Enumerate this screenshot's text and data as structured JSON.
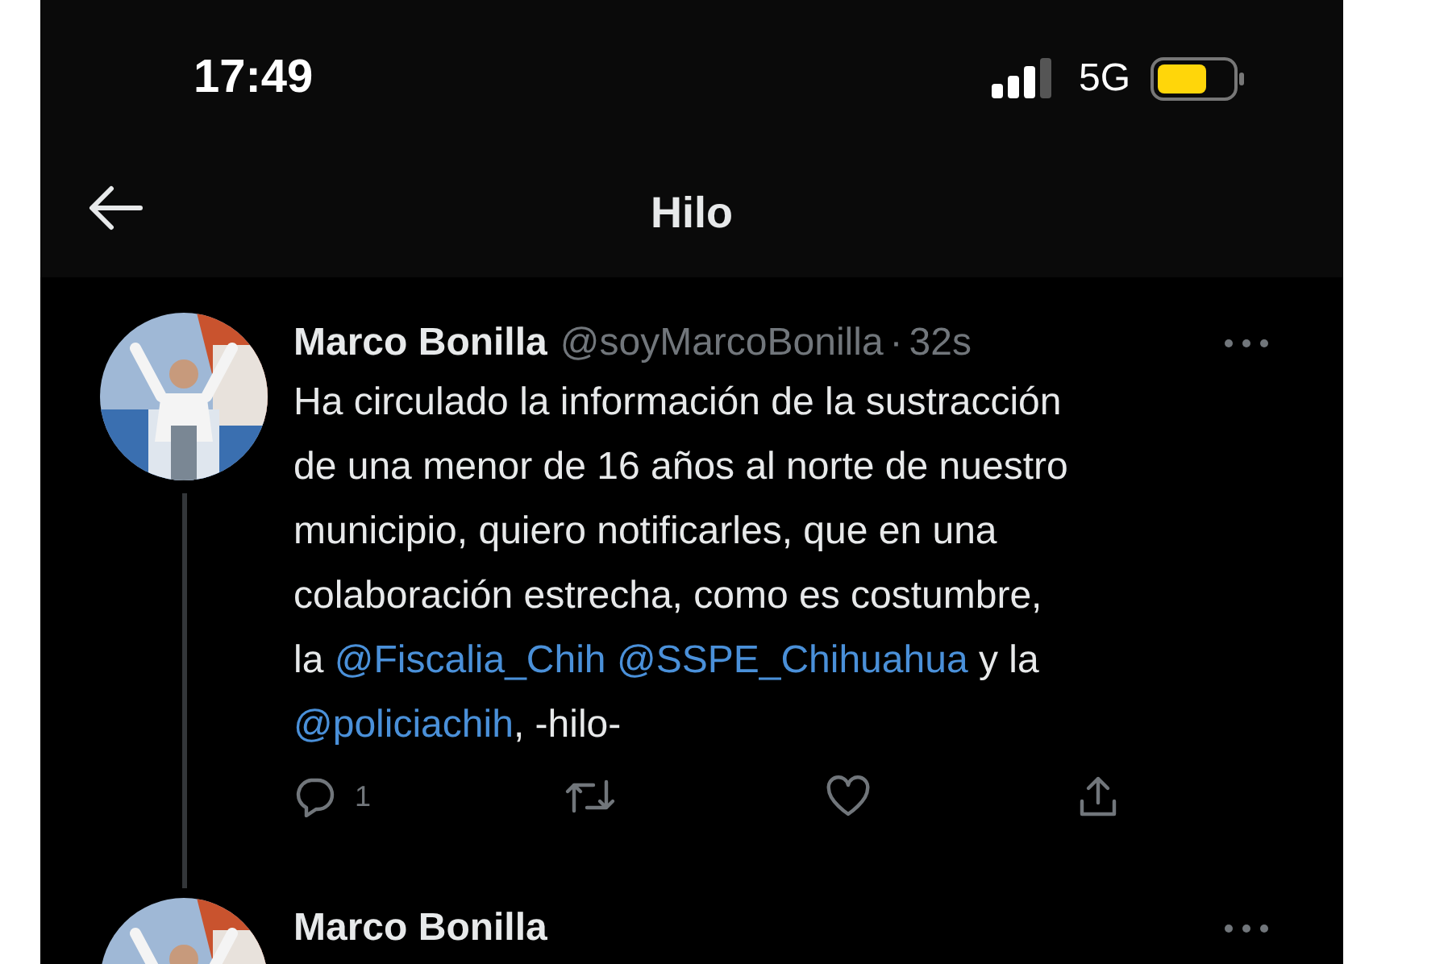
{
  "status_bar": {
    "time": "17:49",
    "network": "5G"
  },
  "header": {
    "title": "Hilo"
  },
  "tweets": [
    {
      "author": "Marco Bonilla",
      "handle": "@soyMarcoBonilla",
      "separator": "·",
      "time": "32s",
      "thread_line": true,
      "lines": [
        [
          {
            "kind": "text",
            "text": "Ha circulado la información de la sustracción"
          }
        ],
        [
          {
            "kind": "text",
            "text": "de una menor de 16 años al norte de nuestro"
          }
        ],
        [
          {
            "kind": "text",
            "text": "municipio, quiero notificarles, que en una"
          }
        ],
        [
          {
            "kind": "text",
            "text": "colaboración estrecha, como es costumbre,"
          }
        ],
        [
          {
            "kind": "text",
            "text": "la "
          },
          {
            "kind": "mention",
            "text": "@Fiscalia_Chih"
          },
          {
            "kind": "mention",
            "text": "@SSPE_Chihuahua"
          },
          {
            "kind": "text",
            "text": " y la"
          }
        ],
        [
          {
            "kind": "mention",
            "text": "@policiachih"
          },
          {
            "kind": "text",
            "text": ", -hilo-"
          }
        ]
      ],
      "reply_count": "1"
    },
    {
      "author": "Marco Bonilla",
      "thread_line": false
    }
  ]
}
